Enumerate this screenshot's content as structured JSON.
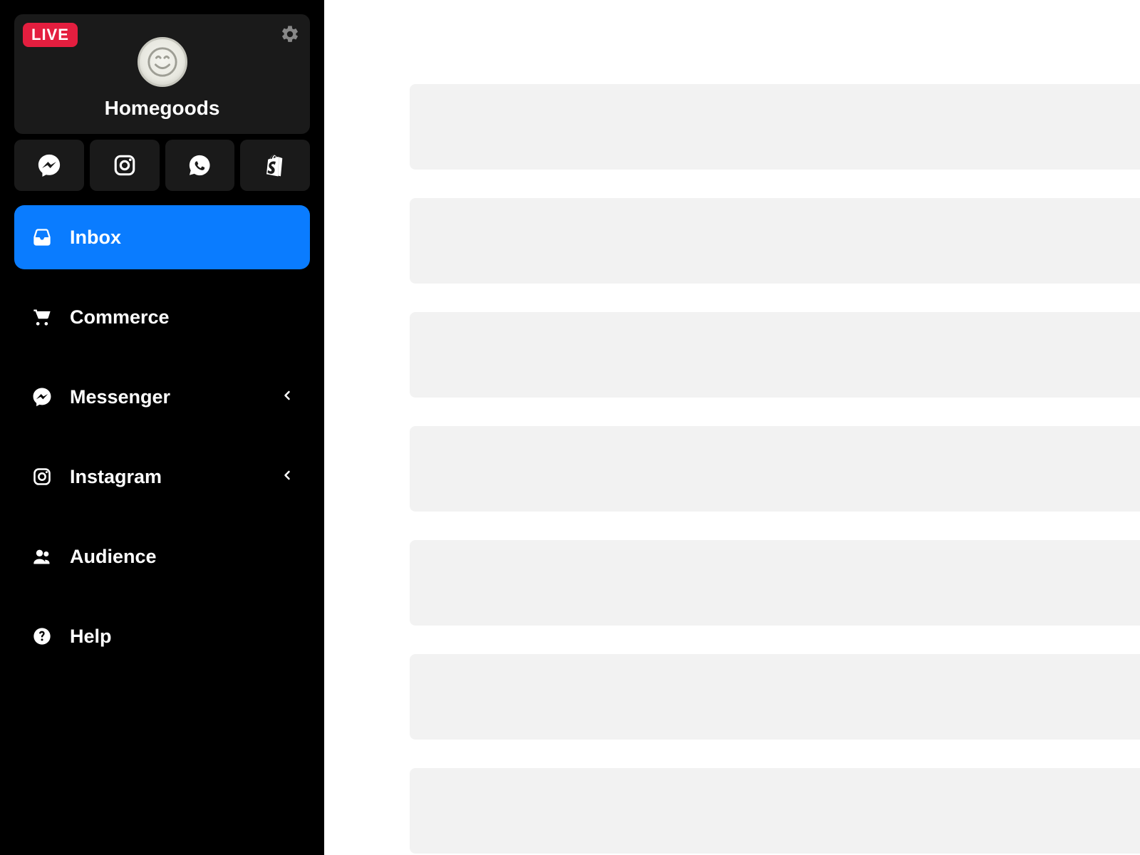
{
  "sidebar": {
    "live_badge": "LIVE",
    "brand_name": "Homegoods",
    "channels": [
      {
        "id": "messenger",
        "icon": "messenger-icon"
      },
      {
        "id": "instagram",
        "icon": "instagram-icon"
      },
      {
        "id": "whatsapp",
        "icon": "whatsapp-icon"
      },
      {
        "id": "shopify",
        "icon": "shopify-icon"
      }
    ],
    "nav": [
      {
        "id": "inbox",
        "label": "Inbox",
        "icon": "inbox-icon",
        "active": true,
        "expandable": false
      },
      {
        "id": "commerce",
        "label": "Commerce",
        "icon": "cart-icon",
        "active": false,
        "expandable": false
      },
      {
        "id": "messenger",
        "label": "Messenger",
        "icon": "messenger-icon",
        "active": false,
        "expandable": true
      },
      {
        "id": "instagram",
        "label": "Instagram",
        "icon": "instagram-icon",
        "active": false,
        "expandable": true
      },
      {
        "id": "audience",
        "label": "Audience",
        "icon": "people-icon",
        "active": false,
        "expandable": false
      },
      {
        "id": "help",
        "label": "Help",
        "icon": "help-icon",
        "active": false,
        "expandable": false
      }
    ]
  },
  "main": {
    "skeleton_rows": 7
  },
  "colors": {
    "accent": "#0A7CFF",
    "live": "#e41e3f",
    "sidebar_bg": "#000000",
    "card_bg": "#1a1a1a",
    "skeleton": "#f2f2f2"
  }
}
